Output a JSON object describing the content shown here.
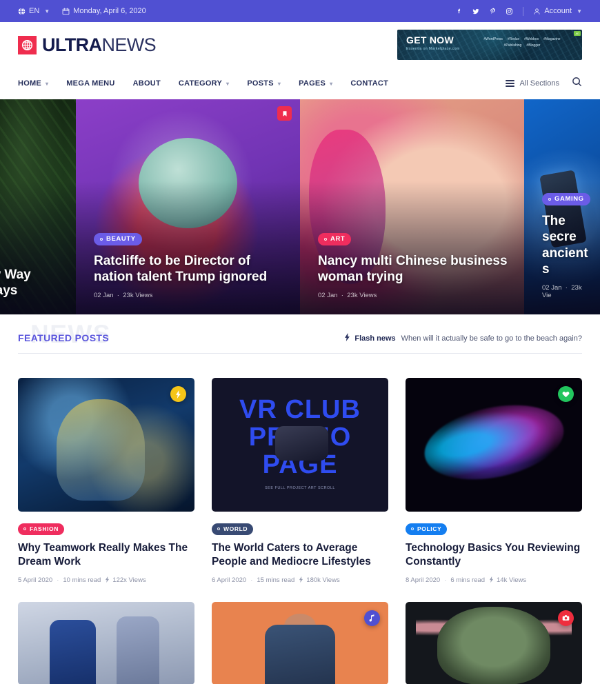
{
  "topbar": {
    "language": "EN",
    "date": "Monday, April 6, 2020",
    "social": [
      "facebook-icon",
      "twitter-icon",
      "pinterest-icon",
      "instagram-icon"
    ],
    "account_label": "Account"
  },
  "header": {
    "logo_bold": "ULTRA",
    "logo_light": "NEWS",
    "ad": {
      "title": "GET NOW",
      "subtitle": "Essentia on Marketplace.com",
      "tags": [
        "#WordPress",
        "#Redux",
        "#Webbox",
        "#Magazine",
        "#Publishing",
        "#Blogger"
      ],
      "corner": "AD"
    }
  },
  "nav": {
    "items": [
      {
        "label": "HOME",
        "dropdown": true
      },
      {
        "label": "MEGA MENU",
        "dropdown": false
      },
      {
        "label": "ABOUT",
        "dropdown": false
      },
      {
        "label": "CATEGORY",
        "dropdown": true
      },
      {
        "label": "POSTS",
        "dropdown": true
      },
      {
        "label": "PAGES",
        "dropdown": true
      },
      {
        "label": "CONTACT",
        "dropdown": false
      }
    ],
    "sections_label": "All Sections",
    "search_icon": "search-icon"
  },
  "hero": {
    "slides": [
      {
        "category": "",
        "category_color": "",
        "title": "New Way\nrt Says",
        "title_line1": "New Way",
        "title_line2": "rt Says",
        "date": "",
        "views": "",
        "art": "art-leaf",
        "flag": false
      },
      {
        "category": "BEAUTY",
        "category_color": "#6b5ce7",
        "title_line1": "Ratcliffe to be Director of",
        "title_line2": "nation talent Trump ignored",
        "date": "02 Jan",
        "views": "23k Views",
        "art": "art-beauty",
        "flag": true
      },
      {
        "category": "ART",
        "category_color": "#ef2d5e",
        "title_line1": "Nancy multi Chinese business",
        "title_line2": "woman trying",
        "date": "02 Jan",
        "views": "23k Views",
        "art": "art-art",
        "flag": false
      },
      {
        "category": "GAMING",
        "category_color": "#6b5ce7",
        "title_line1": "The secre",
        "title_line2": "ancient s",
        "date": "02 Jan",
        "views": "23k Vie",
        "art": "art-game",
        "flag": false
      }
    ]
  },
  "featured": {
    "watermark": "NEWS",
    "title": "FEATURED POSTS",
    "flash_label": "Flash news",
    "flash_icon": "flash-icon",
    "flash_text": "When will it actually be safe to go to the beach again?",
    "cards": [
      {
        "category": "FASHION",
        "category_color": "#ef2d5e",
        "title": "Why Teamwork Really Makes The Dream Work",
        "date": "5 April 2020",
        "read_time": "10 mins read",
        "views": "122x Views",
        "art": "art-cyber",
        "fab": {
          "icon": "bolt-icon",
          "color": "#f5c518",
          "glyph": "⚡"
        }
      },
      {
        "category": "WORLD",
        "category_color": "#384a73",
        "title": "The World Caters to Average People and Mediocre Lifestyles",
        "date": "6 April 2020",
        "read_time": "15 mins read",
        "views": "180k Views",
        "art": "art-vr",
        "vr_line1": "VR CLUB",
        "vr_line2": "PROMO PAGE",
        "vr_footer": "SEE FULL PROJECT  ART SCROLL",
        "fab": null
      },
      {
        "category": "POLICY",
        "category_color": "#147ef0",
        "title": "Technology Basics You Reviewing Constantly",
        "date": "8 April 2020",
        "read_time": "6 mins read",
        "views": "14k Views",
        "art": "art-neon",
        "fab": {
          "icon": "heart-icon",
          "color": "#22c55e",
          "glyph": "♥"
        }
      },
      {
        "category": "",
        "title": "",
        "date": "",
        "read_time": "",
        "views": "",
        "art": "art-street",
        "fab": null
      },
      {
        "category": "",
        "title": "",
        "date": "",
        "read_time": "",
        "views": "",
        "art": "art-orange",
        "fab": {
          "icon": "music-icon",
          "color": "#5050d2",
          "glyph": "♪"
        }
      },
      {
        "category": "",
        "title": "",
        "date": "",
        "read_time": "",
        "views": "",
        "art": "art-orc",
        "fab": {
          "icon": "camera-icon",
          "color": "#ef2d3e",
          "glyph": "◉"
        }
      }
    ]
  },
  "colors": {
    "topbar": "#5050d2",
    "brand_red": "#ef2d4e",
    "accent_indigo": "#5a55dd",
    "text_dark": "#171c3a"
  }
}
